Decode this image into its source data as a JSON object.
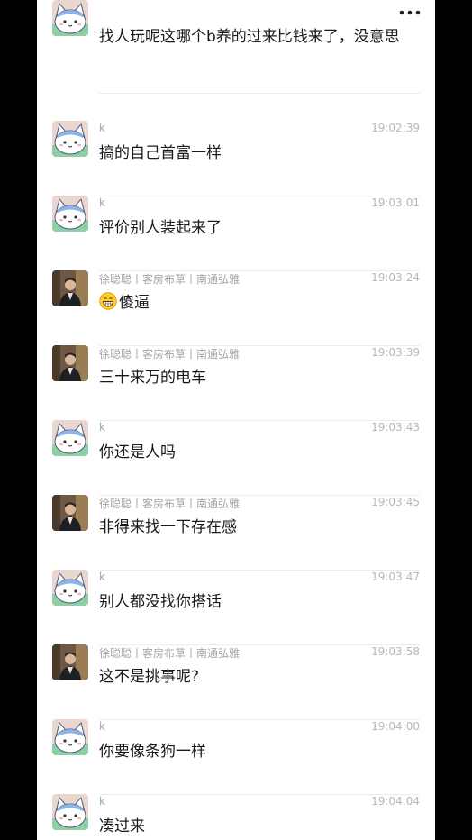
{
  "header": {
    "back_icon": "chevron-left-icon",
    "more_icon": "ellipsis-icon"
  },
  "messages": [
    {
      "sender": "",
      "time": "",
      "text": "找人玩呢这哪个b养的过来比钱来了，没意思",
      "avatar": "cat"
    },
    {
      "sender": "k",
      "time": "19:02:39",
      "text": "搞的自己首富一样",
      "avatar": "cat"
    },
    {
      "sender": "k",
      "time": "19:03:01",
      "text": "评价别人装起来了",
      "avatar": "cat"
    },
    {
      "sender": "徐聪聪丨客房布草丨南通弘雅",
      "time": "19:03:24",
      "text": "傻逼",
      "avatar": "man",
      "emoji": "grinning-face-icon"
    },
    {
      "sender": "徐聪聪丨客房布草丨南通弘雅",
      "time": "19:03:39",
      "text": "三十来万的电车",
      "avatar": "man"
    },
    {
      "sender": "k",
      "time": "19:03:43",
      "text": "你还是人吗",
      "avatar": "cat"
    },
    {
      "sender": "徐聪聪丨客房布草丨南通弘雅",
      "time": "19:03:45",
      "text": "非得来找一下存在感",
      "avatar": "man"
    },
    {
      "sender": "k",
      "time": "19:03:47",
      "text": "别人都没找你搭话",
      "avatar": "cat"
    },
    {
      "sender": "徐聪聪丨客房布草丨南通弘雅",
      "time": "19:03:58",
      "text": "这不是挑事呢?",
      "avatar": "man"
    },
    {
      "sender": "k",
      "time": "19:04:00",
      "text": "你要像条狗一样",
      "avatar": "cat"
    },
    {
      "sender": "k",
      "time": "19:04:04",
      "text": "凑过来",
      "avatar": "cat"
    }
  ],
  "colors": {
    "background": "#ffffff",
    "sender_text": "#a5a5a5",
    "time_text": "#b8b8b8",
    "message_text": "#1a1a1a",
    "divider": "#ececec"
  }
}
